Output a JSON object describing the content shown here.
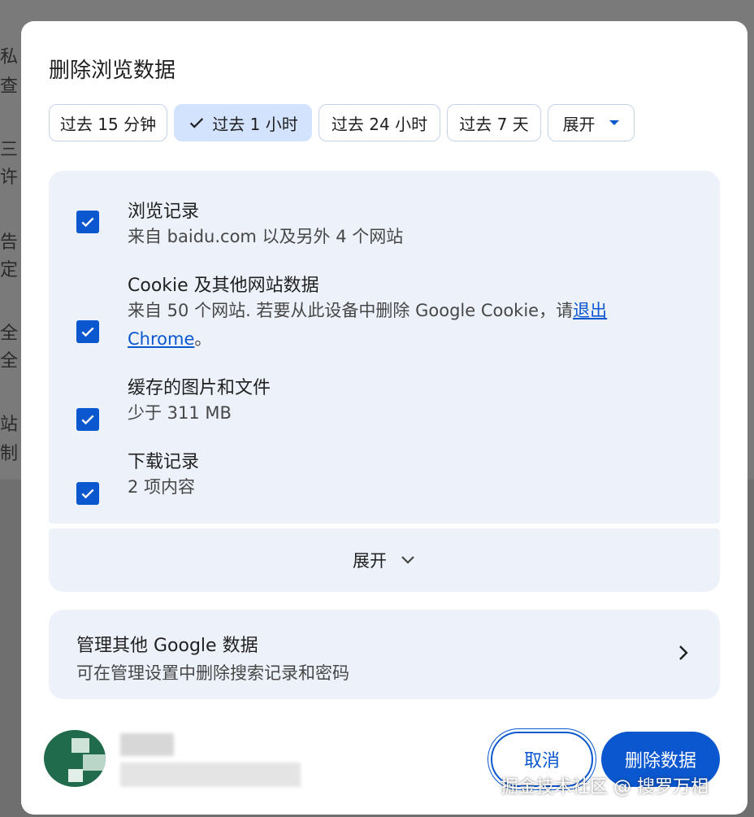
{
  "background_page": {
    "fragments": [
      "私",
      "查",
      "三",
      "许",
      "告",
      "定",
      "全",
      "全",
      "站",
      "制"
    ]
  },
  "dialog": {
    "title": "删除浏览数据",
    "time_ranges": [
      {
        "label": "过去 15 分钟",
        "selected": false
      },
      {
        "label": "过去 1 小时",
        "selected": true
      },
      {
        "label": "过去 24 小时",
        "selected": false
      },
      {
        "label": "过去 7 天",
        "selected": false
      }
    ],
    "more_ranges_label": "展开",
    "items": [
      {
        "title": "浏览记录",
        "subtitle": "来自 baidu.com 以及另外 4 个网站",
        "checked": true
      },
      {
        "title": "Cookie 及其他网站数据",
        "subtitle": "来自 50 个网站. 若要从此设备中删除 Google Cookie，请",
        "link": "退出 Chrome",
        "suffix": "。",
        "checked": true
      },
      {
        "title": "缓存的图片和文件",
        "subtitle": "少于 311 MB",
        "checked": true
      },
      {
        "title": "下载记录",
        "subtitle": "2 项内容",
        "checked": true
      }
    ],
    "expand_label": "展开",
    "manage": {
      "title": "管理其他 Google 数据",
      "subtitle": "可在管理设置中删除搜索记录和密码"
    },
    "account": {
      "name": "██",
      "email": "██████████████"
    },
    "cancel_label": "取消",
    "delete_label": "删除数据"
  },
  "watermark": "掘金技术社区 @ 搜罗万相",
  "colors": {
    "accent": "#0b57d0",
    "panel": "#edf2fa",
    "chip_selected": "#d3e3fd",
    "overlay": "#6f6f6f"
  },
  "icons": {
    "check": "check-icon",
    "caret": "caret-down-icon",
    "chevron": "chevron-down-icon",
    "arrow": "chevron-right-icon"
  }
}
